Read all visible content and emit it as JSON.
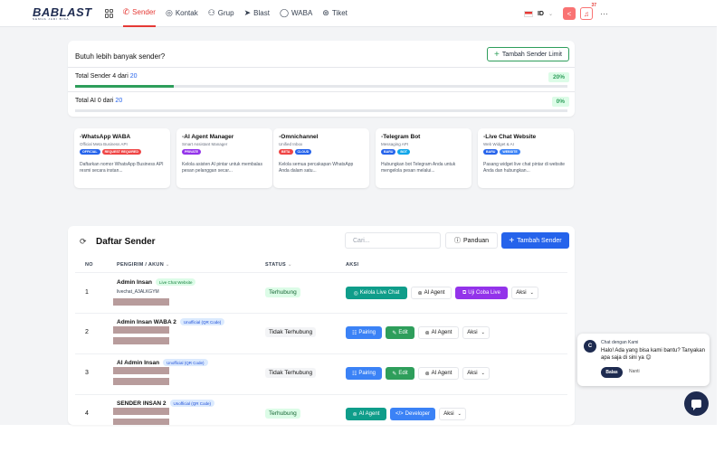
{
  "nav": {
    "brand": "BABLAST",
    "tagline": "SEMUA JADI BISA",
    "items": [
      {
        "label": "Sender",
        "icon": "phone-icon",
        "glyph": "✆",
        "active": true
      },
      {
        "label": "Kontak",
        "icon": "contact-icon",
        "glyph": "◎",
        "active": false
      },
      {
        "label": "Grup",
        "icon": "users-icon",
        "glyph": "⚇",
        "active": false
      },
      {
        "label": "Blast",
        "icon": "send-icon",
        "glyph": "➤",
        "active": false
      },
      {
        "label": "WABA",
        "icon": "whatsapp-icon",
        "glyph": "◯",
        "active": false
      },
      {
        "label": "Tiket",
        "icon": "ticket-icon",
        "glyph": "⊛",
        "active": false
      }
    ],
    "lang": "ID",
    "notif_count": "37",
    "more": "···"
  },
  "limits": {
    "heading": "Butuh lebih banyak sender?",
    "add_limit_label": "Tambah Sender Limit",
    "sender": {
      "prefix": "Total Sender",
      "used": "4",
      "mid": "dari",
      "total": "20",
      "percent": "20%",
      "fraction": 0.2
    },
    "ai": {
      "prefix": "Total AI",
      "used": "0",
      "mid": "dari",
      "total": "20",
      "percent": "0%",
      "fraction": 0
    }
  },
  "features": [
    {
      "title": "WhatsApp WABA",
      "subtitle": "Official Meta Business API",
      "badges": [
        {
          "text": "OFFICIAL",
          "color": "#2563eb"
        },
        {
          "text": "REQUEST REQUIRED",
          "color": "#ef4444"
        }
      ],
      "desc": "Daftarkan nomor WhatsApp Business API resmi secara instan..."
    },
    {
      "title": "AI Agent Manager",
      "subtitle": "Smart Assistant Manager",
      "badges": [
        {
          "text": "PRIVATE",
          "color": "#9333ea"
        }
      ],
      "desc": "Kelola asisten AI pintar untuk membalas pesan pelanggan secar..."
    },
    {
      "title": "Omnichannel",
      "subtitle": "Unified Inbox",
      "badges": [
        {
          "text": "BETA",
          "color": "#ef4444"
        },
        {
          "text": "CLOUD",
          "color": "#2563eb"
        }
      ],
      "desc": "Kelola semua percakapan WhatsApp Anda dalam satu..."
    },
    {
      "title": "Telegram Bot",
      "subtitle": "Messaging API",
      "badges": [
        {
          "text": "BARU",
          "color": "#2563eb"
        },
        {
          "text": "BOT",
          "color": "#0ea5e9"
        }
      ],
      "desc": "Hubungkan bot Telegram Anda untuk mengelola pesan melalui..."
    },
    {
      "title": "Live Chat Website",
      "subtitle": "Web Widget & AI",
      "badges": [
        {
          "text": "BARU",
          "color": "#2563eb"
        },
        {
          "text": "WEBSITE",
          "color": "#3b82f6"
        }
      ],
      "desc": "Pasang widget live chat pintar di website Anda dan hubungkan..."
    }
  ],
  "senders": {
    "title": "Daftar Sender",
    "search_placeholder": "Cari...",
    "guide_label": "Panduan",
    "add_label": "Tambah Sender",
    "columns": {
      "no": "NO",
      "sender": "PENGIRIM / AKUN",
      "sort": "⌄",
      "status": "STATUS",
      "action": "AKSI"
    },
    "rows": [
      {
        "no": "1",
        "name": "Admin Insan",
        "pill": "Live Chat Website",
        "pill_type": "green",
        "id": "livechat_A3ALKGYM",
        "status": "Terhubung",
        "connected": true,
        "actions": [
          {
            "label": "Kelola Live Chat",
            "icon": "◎",
            "style": "teal",
            "w": 68
          },
          {
            "label": "AI Agent",
            "icon": "⊚",
            "style": "plain",
            "w": 45
          },
          {
            "label": "Uji Coba Live",
            "icon": "⧉",
            "style": "purple",
            "w": 58
          },
          {
            "label": "Aksi",
            "icon": "",
            "style": "plain",
            "w": 30
          }
        ]
      },
      {
        "no": "2",
        "name": "Admin Insan WABA 2",
        "pill": "Unofficial (QR Code)",
        "pill_type": "blue",
        "id": "",
        "status": "Tidak Terhubung",
        "connected": false,
        "actions": [
          {
            "label": "Pairing",
            "icon": "☷",
            "style": "blue",
            "w": 40
          },
          {
            "label": "Edit",
            "icon": "✎",
            "style": "green",
            "w": 32
          },
          {
            "label": "AI Agent",
            "icon": "⊚",
            "style": "plain",
            "w": 45
          },
          {
            "label": "Aksi",
            "icon": "",
            "style": "plain",
            "w": 30
          }
        ]
      },
      {
        "no": "3",
        "name": "AI Admin Insan",
        "pill": "Unofficial (QR Code)",
        "pill_type": "blue",
        "id": "",
        "status": "Tidak Terhubung",
        "connected": false,
        "actions": [
          {
            "label": "Pairing",
            "icon": "☷",
            "style": "blue",
            "w": 40
          },
          {
            "label": "Edit",
            "icon": "✎",
            "style": "green",
            "w": 32
          },
          {
            "label": "AI Agent",
            "icon": "⊚",
            "style": "plain",
            "w": 45
          },
          {
            "label": "Aksi",
            "icon": "",
            "style": "plain",
            "w": 30
          }
        ]
      },
      {
        "no": "4",
        "name": "SENDER INSAN 2",
        "pill": "Unofficial (QR Code)",
        "pill_type": "blue",
        "id": "",
        "status": "Terhubung",
        "connected": true,
        "actions": [
          {
            "label": "AI Agent",
            "icon": "⊚",
            "style": "teal",
            "w": 45
          },
          {
            "label": "Developer",
            "icon": "</>",
            "style": "blue",
            "w": 50
          },
          {
            "label": "Aksi",
            "icon": "",
            "style": "plain",
            "w": 30
          }
        ]
      }
    ]
  },
  "chat_widget": {
    "avatar": "C",
    "title": "Chat dengan Kami",
    "message": "Halo! Ada yang bisa kami bantu? Tanyakan apa saja di sini ya 😊",
    "reply_label": "Balas",
    "later_label": "Nanti"
  }
}
